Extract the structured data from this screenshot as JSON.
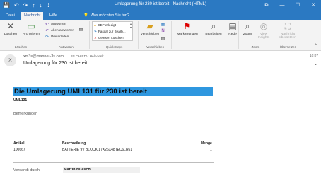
{
  "window": {
    "title": "Umlagerung für 230 ist bereit  -  Nachricht (HTML)",
    "qat": [
      "💾",
      "↶",
      "↷",
      "↑",
      "↓",
      "⇣"
    ],
    "controls": [
      "⧉",
      "—",
      "☐",
      "✕"
    ]
  },
  "tabs": {
    "items": [
      "Datei",
      "Nachricht",
      "Hilfe"
    ],
    "active": "Nachricht",
    "tell_me": "Was möchten Sie tun?"
  },
  "ribbon": {
    "delete_group": {
      "label": "Löschen",
      "delete": "Löschen",
      "archive": "Archivieren"
    },
    "respond_group": {
      "label": "Antworten",
      "reply": "Antworten",
      "reply_all": "Allen antworten",
      "forward": "Weiterleiten"
    },
    "quicksteps_group": {
      "label": "QuickSteps",
      "items": [
        "SEP erledigt",
        "Pascal zur Bearb...",
        "Gelesen Löschen"
      ]
    },
    "move_group": {
      "label": "Verschieben",
      "move": "Verschieben"
    },
    "tags_group": {
      "mark": "Markierungen"
    },
    "edit_group": {
      "edit": "Bearbeiten"
    },
    "speech_group": {
      "speak": "Rede"
    },
    "zoom_group": {
      "label": "Zoom",
      "zoom": "Zoom",
      "view_insights": "View Insights"
    },
    "translate_group": {
      "label": "Übersetzer",
      "translate": "Nachricht übersetzen"
    }
  },
  "header": {
    "avatar": "X",
    "from": "xm3s@manner-3s.com",
    "to": "3S CH EDV Helpdesk",
    "subject": "Umlagerung für 230 ist bereit",
    "time": "10:07"
  },
  "body": {
    "banner": "Die Umlagerung UML131 für 230 ist bereit",
    "code": "UML131",
    "remarks_label": "Bemerkungen",
    "table": {
      "headers": [
        "Artikel",
        "Beschreibung",
        "Menge"
      ],
      "rows": [
        [
          "100667",
          "BATTERIE 9V BLOCK 17X26X48 IEC6LR61",
          "1"
        ]
      ]
    },
    "shipped_by_label": "Versandt durch",
    "shipped_by_value": "Martin Nüesch"
  },
  "colors": {
    "accent": "#2b79c2",
    "banner": "#2f97df"
  }
}
